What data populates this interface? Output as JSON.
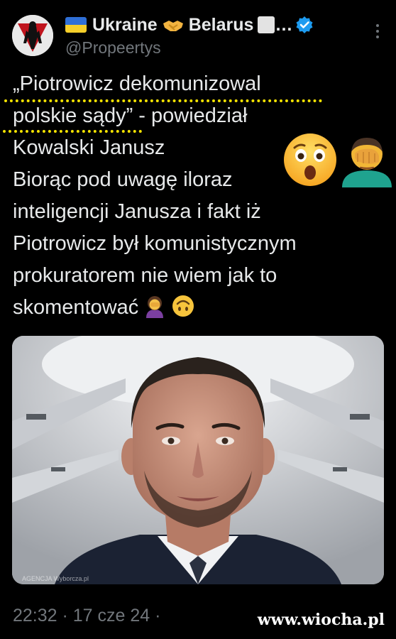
{
  "header": {
    "display_name_part1": "Ukraine",
    "display_name_part2": "Belarus",
    "display_name_ellipsis": "…",
    "handle": "@Propeertys",
    "verified": true,
    "icons": [
      "ukraine-flag-emoji",
      "handshake-emoji",
      "white-square-emoji",
      "verified-badge",
      "more-options-icon"
    ]
  },
  "tweet": {
    "lines": [
      "„Piotrowicz dekomunizowal",
      "polskie sądy” - powiedział",
      "Kowalski Janusz",
      "Biorąc pod uwagę iloraz",
      "inteligencji Janusza i fakt iż",
      "Piotrowicz był komunistycznym",
      "prokuratorem nie wiem jak to",
      "skomentować"
    ],
    "emojis": [
      "astonished-face-emoji",
      "man-facepalming-emoji",
      "woman-facepalming-emoji",
      "upside-down-face-emoji"
    ],
    "highlight_color": "#f5e300"
  },
  "media": {
    "photo_credit": "AGENCJA Wyborcza.pl"
  },
  "footer": {
    "timestamp": "22:32 · 17 cze 24 ·"
  },
  "watermark": "www.wiocha.pl",
  "colors": {
    "background": "#000000",
    "text": "#e7e9ea",
    "secondary_text": "#71767b",
    "verified_blue": "#1d9bf0"
  }
}
